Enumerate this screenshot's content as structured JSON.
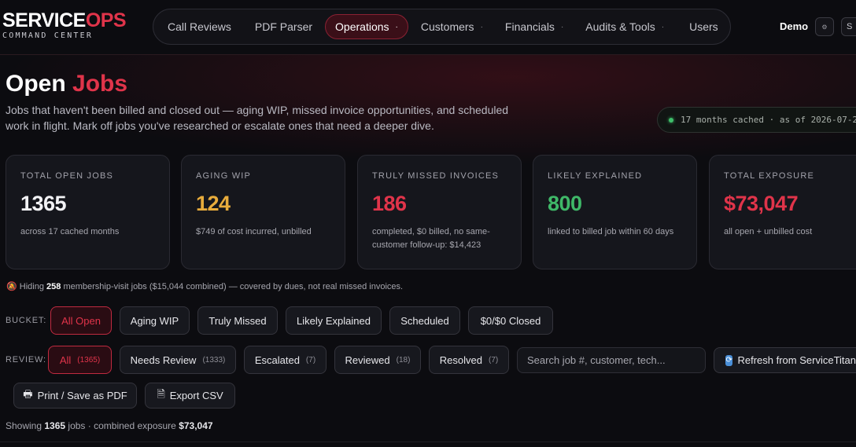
{
  "brand": {
    "name_a": "SERVICE",
    "name_b": "OPS",
    "subtitle": "COMMAND CENTER"
  },
  "nav": {
    "items": [
      {
        "label": "Call Reviews",
        "caret": ""
      },
      {
        "label": "PDF Parser",
        "caret": ""
      },
      {
        "label": "Operations",
        "caret": "·"
      },
      {
        "label": "Customers",
        "caret": "·"
      },
      {
        "label": "Financials",
        "caret": "·"
      },
      {
        "label": "Audits & Tools",
        "caret": "·"
      },
      {
        "label": "Users",
        "caret": ""
      }
    ],
    "user": "Demo",
    "settings_glyph": "⚙",
    "cut_button": "S"
  },
  "page": {
    "title_a": "Open",
    "title_b": "Jobs",
    "description": "Jobs that haven't been billed and closed out — aging WIP, missed invoice opportunities, and scheduled work in flight. Mark off jobs you've researched or escalate ones that need a deeper dive.",
    "cache_status": "17 months cached · as of 2026-07-2"
  },
  "stats": [
    {
      "label": "TOTAL OPEN JOBS",
      "value": "1365",
      "note": "across 17 cached months",
      "color": "#f2f2f5"
    },
    {
      "label": "AGING WIP",
      "value": "124",
      "note": "$749 of cost incurred, unbilled",
      "color": "#e8ac3c"
    },
    {
      "label": "TRULY MISSED INVOICES",
      "value": "186",
      "note": "completed, $0 billed, no same-customer follow-up: $14,423",
      "color": "#e0344a"
    },
    {
      "label": "LIKELY EXPLAINED",
      "value": "800",
      "note": "linked to billed job within 60 days",
      "color": "#3fb868"
    },
    {
      "label": "TOTAL EXPOSURE",
      "value": "$73,047",
      "note": "all open + unbilled cost",
      "color": "#e0344a"
    }
  ],
  "hiding": {
    "icon": "🔕",
    "prefix": "Hiding",
    "count": "258",
    "suffix": "membership-visit jobs ($15,044 combined) — covered by dues, not real missed invoices."
  },
  "bucket": {
    "label": "BUCKET:",
    "options": [
      "All Open",
      "Aging WIP",
      "Truly Missed",
      "Likely Explained",
      "Scheduled",
      "$0/$0 Closed"
    ],
    "selected": "All Open"
  },
  "review": {
    "label": "REVIEW:",
    "options": [
      {
        "label": "All",
        "count": "(1365)"
      },
      {
        "label": "Needs Review",
        "count": "(1333)"
      },
      {
        "label": "Escalated",
        "count": "(7)"
      },
      {
        "label": "Reviewed",
        "count": "(18)"
      },
      {
        "label": "Resolved",
        "count": "(7)"
      }
    ],
    "selected": "All",
    "search_placeholder": "Search job #, customer, tech...",
    "refresh_label": "Refresh from ServiceTitan"
  },
  "actions": {
    "print_label": "Print / Save as PDF",
    "export_label": "Export CSV"
  },
  "summary": {
    "prefix": "Showing",
    "count": "1365",
    "middle": "jobs · combined exposure",
    "exposure": "$73,047"
  }
}
